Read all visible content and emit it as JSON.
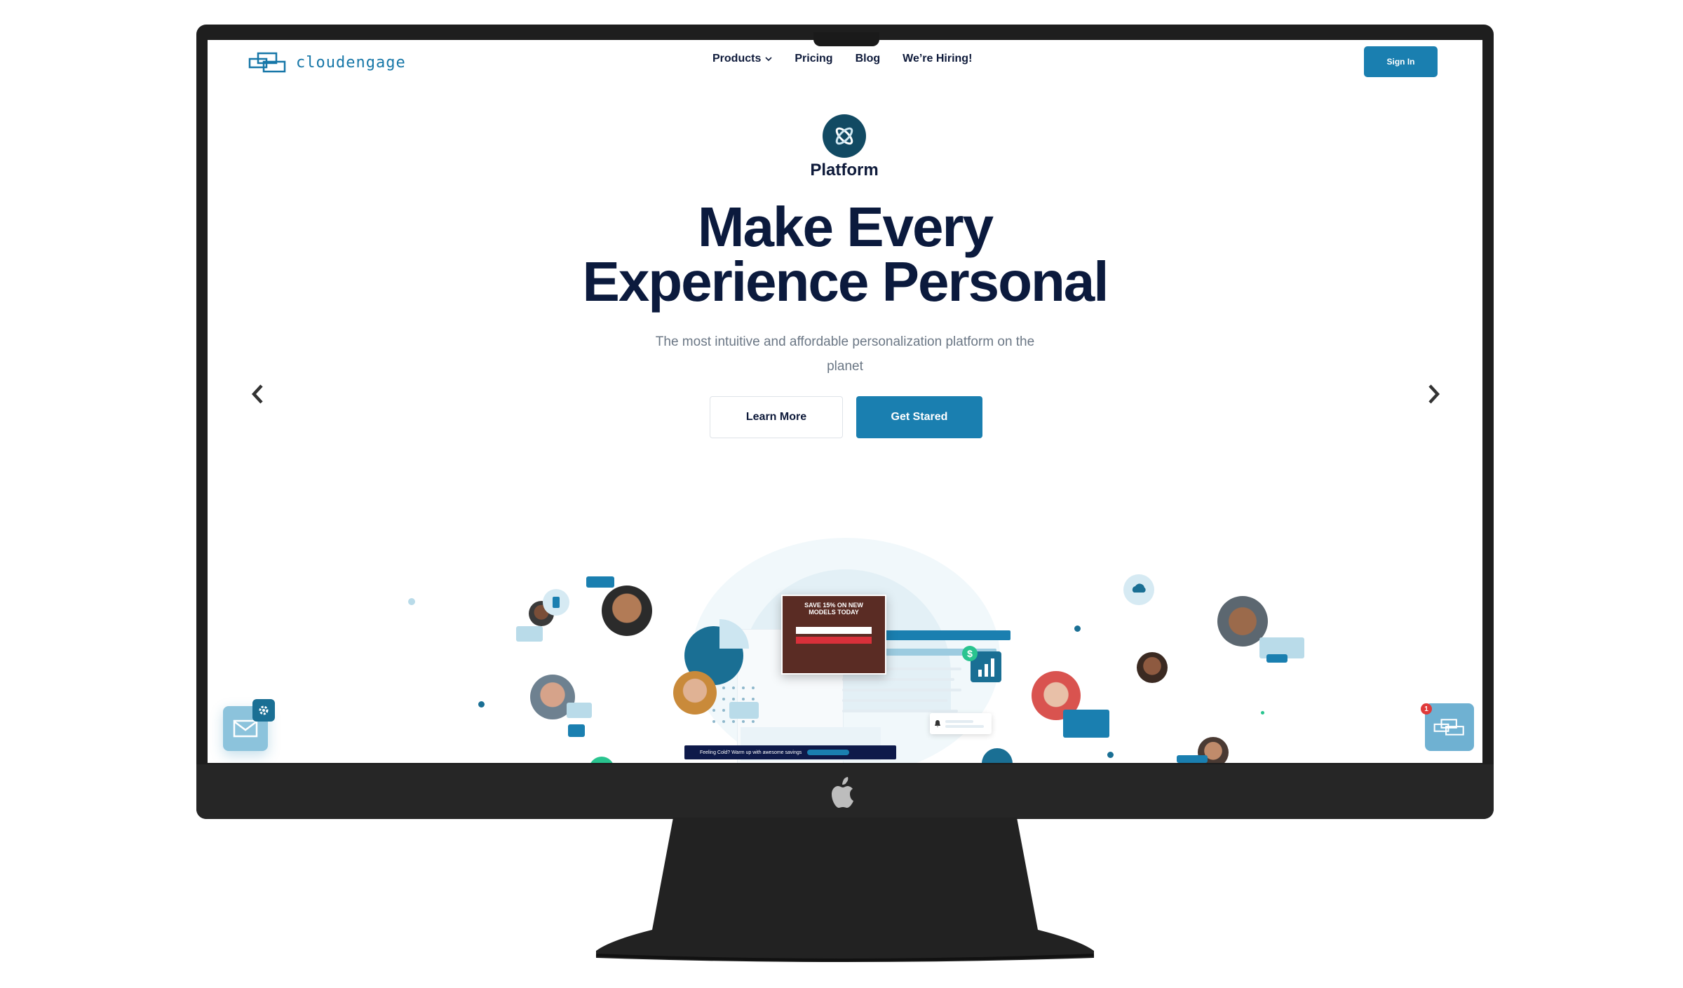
{
  "header": {
    "logo_text": "cloudengage",
    "nav": [
      {
        "label": "Products",
        "has_dropdown": true
      },
      {
        "label": "Pricing"
      },
      {
        "label": "Blog"
      },
      {
        "label": "We’re Hiring!"
      }
    ],
    "signin_label": "Sign In"
  },
  "hero": {
    "product_label": "Platform",
    "headline_line1": "Make Every",
    "headline_line2": "Experience Personal",
    "subtitle_line1": "The most intuitive and affordable personalization platform on the",
    "subtitle_line2": "planet",
    "learn_more_label": "Learn More",
    "get_started_label": "Get Stared"
  },
  "illustration": {
    "promo_title_line1": "SAVE 15% ON NEW",
    "promo_title_line2": "MODELS TODAY",
    "banner_text": "Feeling Cold? Warm up with awesome savings"
  },
  "widgets": {
    "chat_badge_count": "1"
  },
  "colors": {
    "primary": "#1a7fb0",
    "navy": "#0b1a3d",
    "teal_dark": "#124a63",
    "light_blue": "#b9dbe9",
    "bezel": "#1e1e1e"
  },
  "icons": [
    "apple-logo-icon",
    "chevron-left-icon",
    "chevron-right-icon",
    "chevron-down-icon",
    "envelope-icon",
    "gear-icon",
    "chat-icon",
    "dollar-icon",
    "bar-chart-icon",
    "weather-icon",
    "bell-icon",
    "phone-icon"
  ]
}
